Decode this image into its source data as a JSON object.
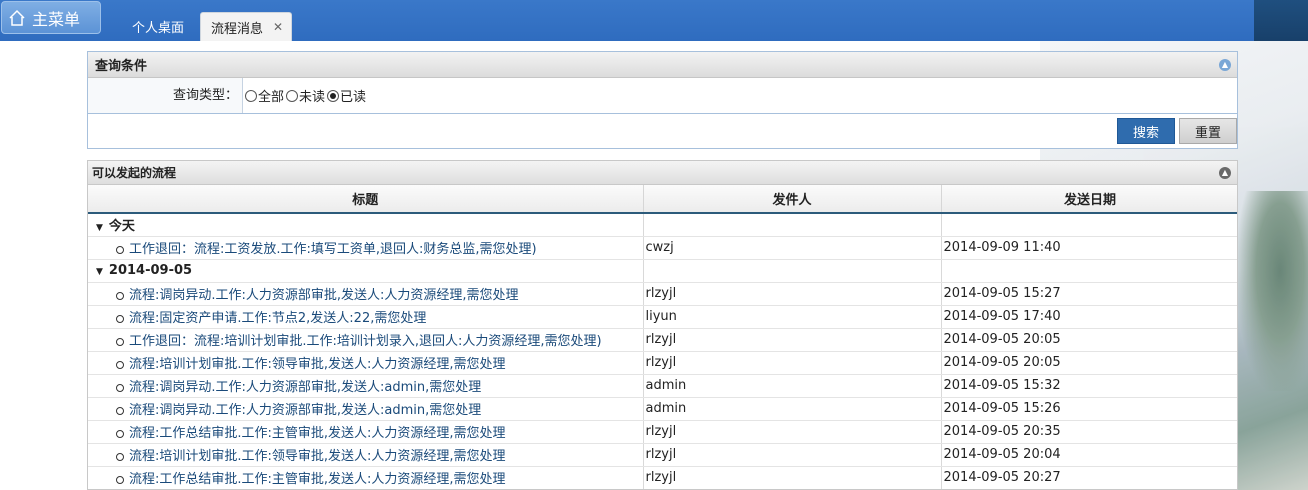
{
  "topbar": {
    "main_menu": "主菜单",
    "tabs": [
      {
        "label": "个人桌面",
        "active": false
      },
      {
        "label": "流程消息",
        "active": true,
        "close": "✕"
      }
    ]
  },
  "query": {
    "title": "查询条件",
    "label": "查询类型：",
    "options": [
      {
        "label": "全部",
        "checked": false
      },
      {
        "label": "未读",
        "checked": false
      },
      {
        "label": "已读",
        "checked": true
      }
    ],
    "search_label": "搜索",
    "reset_label": "重置"
  },
  "flows": {
    "title": "可以发起的流程",
    "columns": [
      "标题",
      "发件人",
      "发送日期"
    ],
    "groups": [
      {
        "name": "今天",
        "rows": [
          {
            "title": "工作退回：流程:工资发放.工作:填写工资单,退回人:财务总监,需您处理)",
            "sender": "cwzj",
            "date": "2014-09-09 11:40"
          }
        ]
      },
      {
        "name": "2014-09-05",
        "rows": [
          {
            "title": "流程:调岗异动.工作:人力资源部审批,发送人:人力资源经理,需您处理",
            "sender": "rlzyjl",
            "date": "2014-09-05 15:27"
          },
          {
            "title": "流程:固定资产申请.工作:节点2,发送人:22,需您处理",
            "sender": "liyun",
            "date": "2014-09-05 17:40"
          },
          {
            "title": "工作退回：流程:培训计划审批.工作:培训计划录入,退回人:人力资源经理,需您处理)",
            "sender": "rlzyjl",
            "date": "2014-09-05 20:05"
          },
          {
            "title": "流程:培训计划审批.工作:领导审批,发送人:人力资源经理,需您处理",
            "sender": "rlzyjl",
            "date": "2014-09-05 20:05"
          },
          {
            "title": "流程:调岗异动.工作:人力资源部审批,发送人:admin,需您处理",
            "sender": "admin",
            "date": "2014-09-05 15:32"
          },
          {
            "title": "流程:调岗异动.工作:人力资源部审批,发送人:admin,需您处理",
            "sender": "admin",
            "date": "2014-09-05 15:26"
          },
          {
            "title": "流程:工作总结审批.工作:主管审批,发送人:人力资源经理,需您处理",
            "sender": "rlzyjl",
            "date": "2014-09-05 20:35"
          },
          {
            "title": "流程:培训计划审批.工作:领导审批,发送人:人力资源经理,需您处理",
            "sender": "rlzyjl",
            "date": "2014-09-05 20:04"
          },
          {
            "title": "流程:工作总结审批.工作:主管审批,发送人:人力资源经理,需您处理",
            "sender": "rlzyjl",
            "date": "2014-09-05 20:27"
          }
        ]
      }
    ]
  }
}
